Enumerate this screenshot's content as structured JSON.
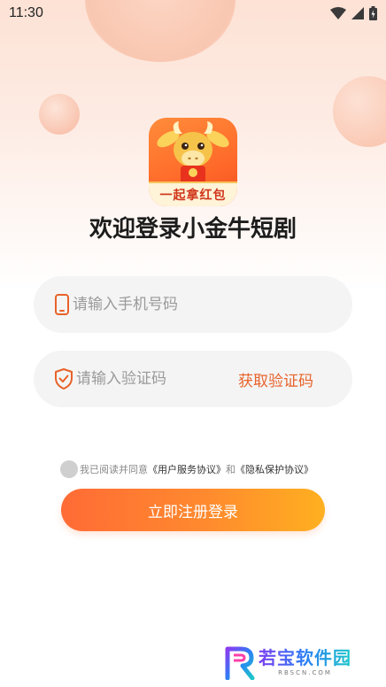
{
  "status_bar": {
    "time": "11:30",
    "icons": [
      "wifi-icon",
      "signal-icon",
      "battery-icon"
    ]
  },
  "app": {
    "logo_banner": "一起拿红包",
    "welcome_title": "欢迎登录小金牛短剧"
  },
  "form": {
    "phone_placeholder": "请输入手机号码",
    "code_placeholder": "请输入验证码",
    "get_code_label": "获取验证码",
    "submit_label": "立即注册登录"
  },
  "agreement": {
    "prefix": "我已阅读并同意",
    "user_agreement": "《用户服务协议》",
    "conjunction": "和",
    "privacy_agreement": "《隐私保护协议》"
  },
  "watermark": {
    "name": "若宝软件园",
    "sub": "RBSCN.COM"
  },
  "colors": {
    "accent": "#e8622a",
    "button_start": "#ff6b35",
    "button_end": "#ffb020",
    "field_bg": "#f4f4f4"
  }
}
